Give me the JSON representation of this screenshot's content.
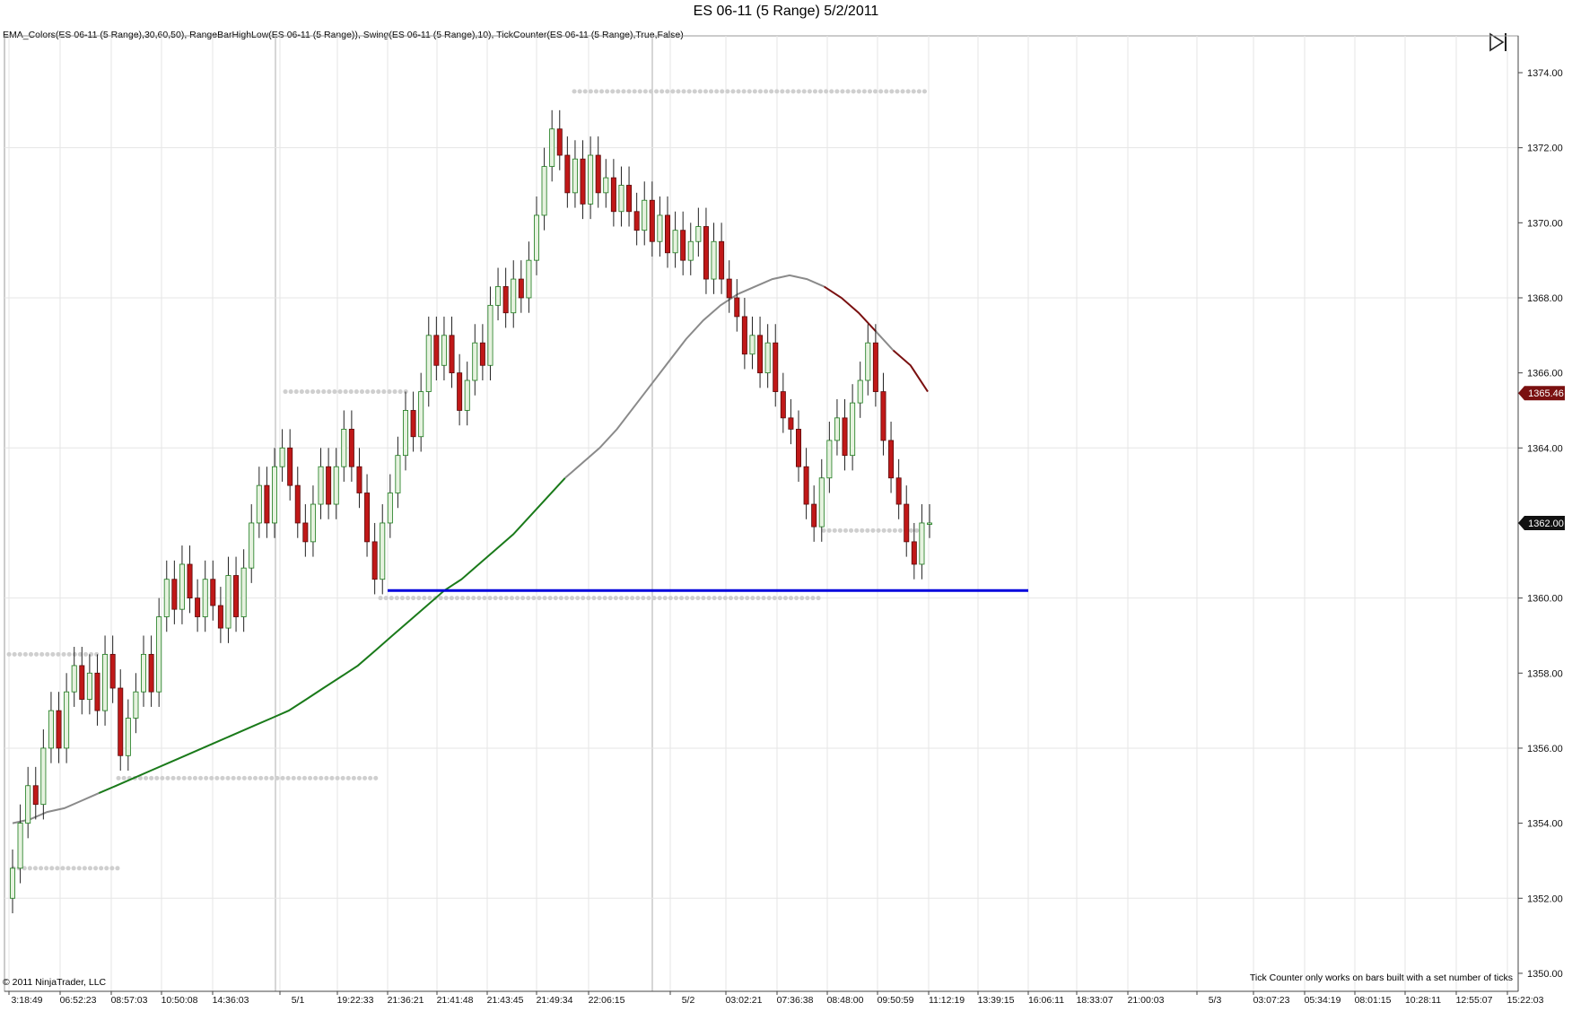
{
  "title": "ES 06-11 (5 Range)  5/2/2011",
  "indicators_label": "EMA_Colors(ES 06-11 (5 Range),30,60,50), RangeBarHighLow(ES 06-11 (5 Range)), Swing(ES 06-11 (5 Range),10), TickCounter(ES 06-11 (5 Range),True,False)",
  "copyright": "© 2011 NinjaTrader, LLC",
  "tick_counter_note": "Tick Counter only works on bars built with a set number of ticks",
  "icons": {
    "play": "play-to-end-icon"
  },
  "colors": {
    "up_candle": "#e6f2df",
    "up_candle_border": "#1a7a1a",
    "down_candle": "#c01818",
    "ema_up": "#1a7a1a",
    "ema_neutral": "#8a8a8a",
    "ema_down": "#7a1010",
    "swing_dots": "#cfcfcf",
    "support_line": "#0000dd",
    "price_marker": "#7a1010",
    "current_marker": "#111111"
  },
  "chart_data": {
    "type": "candlestick",
    "instrument": "ES 06-11 (5 Range)",
    "date": "5/2/2011",
    "ylim": [
      1350,
      1374
    ],
    "y_ticks": [
      "1374.00",
      "1372.00",
      "1370.00",
      "1368.00",
      "1366.00",
      "1364.00",
      "1362.00",
      "1360.00",
      "1358.00",
      "1356.00",
      "1354.00",
      "1352.00",
      "1350.00"
    ],
    "x_tick_labels": [
      "3:18:49",
      "06:52:23",
      "08:57:03",
      "10:50:08",
      "14:36:03",
      "5/1",
      "19:22:33",
      "21:36:21",
      "21:41:48",
      "21:43:45",
      "21:49:34",
      "22:06:15",
      "5/2",
      "03:02:21",
      "07:36:38",
      "08:48:00",
      "09:50:59",
      "11:12:19",
      "13:39:15",
      "16:06:11",
      "18:33:07",
      "21:00:03",
      "5/3",
      "03:07:23",
      "05:34:19",
      "08:01:15",
      "10:28:11",
      "12:55:07",
      "15:22:03"
    ],
    "price_markers": [
      {
        "label": "1365.46",
        "value": 1365.46,
        "kind": "ema"
      },
      {
        "label": "1362.00",
        "value": 1362.0,
        "kind": "last"
      }
    ],
    "candle_closes": [
      1352.8,
      1354.0,
      1355.0,
      1354.5,
      1356.0,
      1357.0,
      1356.0,
      1357.5,
      1358.2,
      1357.3,
      1358.0,
      1357.0,
      1358.5,
      1357.6,
      1355.8,
      1356.8,
      1357.5,
      1358.5,
      1357.5,
      1359.5,
      1360.5,
      1359.7,
      1360.9,
      1360.0,
      1359.5,
      1360.5,
      1359.8,
      1359.2,
      1360.6,
      1359.5,
      1360.8,
      1362.0,
      1363.0,
      1362.0,
      1363.5,
      1364.0,
      1363.0,
      1362.0,
      1361.5,
      1362.5,
      1363.5,
      1362.5,
      1363.5,
      1364.5,
      1363.5,
      1362.8,
      1361.5,
      1360.5,
      1362.0,
      1362.8,
      1363.8,
      1365.0,
      1364.3,
      1365.5,
      1367.0,
      1366.2,
      1367.0,
      1366.0,
      1365.0,
      1365.8,
      1366.8,
      1366.2,
      1367.8,
      1368.3,
      1367.6,
      1368.5,
      1368.0,
      1369.0,
      1370.2,
      1371.5,
      1372.5,
      1371.8,
      1370.8,
      1371.7,
      1370.5,
      1371.8,
      1370.8,
      1371.2,
      1370.3,
      1371.0,
      1370.3,
      1369.8,
      1370.6,
      1369.5,
      1370.2,
      1369.2,
      1369.8,
      1369.0,
      1369.5,
      1369.9,
      1368.5,
      1369.5,
      1368.5,
      1368.0,
      1367.5,
      1366.5,
      1367.0,
      1366.0,
      1366.8,
      1365.5,
      1364.8,
      1364.5,
      1363.5,
      1362.5,
      1361.9,
      1363.2,
      1364.2,
      1364.8,
      1363.8,
      1365.2,
      1365.8,
      1366.8,
      1365.5,
      1364.2,
      1363.2,
      1362.5,
      1361.5,
      1360.9,
      1362.0,
      1362.0
    ],
    "ema_values": [
      1354.0,
      1354.1,
      1354.3,
      1354.4,
      1354.6,
      1354.8,
      1355.0,
      1355.2,
      1355.4,
      1355.6,
      1355.8,
      1356.0,
      1356.2,
      1356.4,
      1356.6,
      1356.8,
      1357.0,
      1357.3,
      1357.6,
      1357.9,
      1358.2,
      1358.6,
      1359.0,
      1359.4,
      1359.8,
      1360.2,
      1360.5,
      1360.9,
      1361.3,
      1361.7,
      1362.2,
      1362.7,
      1363.2,
      1363.6,
      1364.0,
      1364.5,
      1365.1,
      1365.7,
      1366.3,
      1366.9,
      1367.4,
      1367.8,
      1368.1,
      1368.3,
      1368.5,
      1368.6,
      1368.5,
      1368.3,
      1368.0,
      1367.6,
      1367.1,
      1366.6,
      1366.2,
      1365.5
    ],
    "ema_label": "EMA_Colors(ES 06-11 (5 Range),30,60,50)",
    "support_level": 1360.2,
    "swing_levels": [
      1373.5,
      1365.5,
      1361.8,
      1360.0,
      1358.5,
      1355.2,
      1352.8
    ],
    "grid": true,
    "axis_side": "right"
  }
}
